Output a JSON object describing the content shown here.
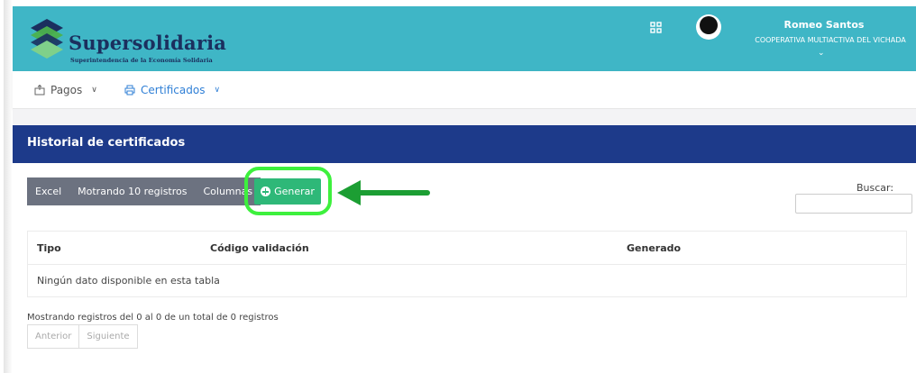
{
  "header": {
    "brand": "Supersolidaria",
    "brand_subtitle": "Superintendencia de la Economía Solidaria",
    "user_name": "Romeo Santos",
    "user_org": "COOPERATIVA MULTIACTIVA DEL VICHADA",
    "user_caret": "⌄",
    "icons": [
      "apps-icon",
      "user-avatar-icon"
    ],
    "bar_color": "#3fb6c6"
  },
  "nav": {
    "items": [
      {
        "label": "Pagos",
        "icon": "payments-icon",
        "caret": "∨"
      },
      {
        "label": "Certificados",
        "icon": "printer-icon",
        "caret": "∨",
        "active": true
      }
    ]
  },
  "panel": {
    "title": "Historial de certificados",
    "color": "#1d3a8a"
  },
  "toolbar": {
    "excel": "Excel",
    "show": "Motrando 10 registros",
    "columns": "Columnas",
    "generate": "Generar"
  },
  "search": {
    "label": "Buscar:",
    "value": ""
  },
  "table": {
    "columns": [
      "Tipo",
      "Código validación",
      "Generado"
    ],
    "empty": "Ningún dato disponible en esta tabla"
  },
  "footer": {
    "info": "Mostrando registros del 0 al 0 de un total de 0 registros",
    "prev": "Anterior",
    "next": "Siguiente"
  },
  "annotation": {
    "highlight_color": "#3df03d",
    "arrow_color": "#1c9e33"
  }
}
